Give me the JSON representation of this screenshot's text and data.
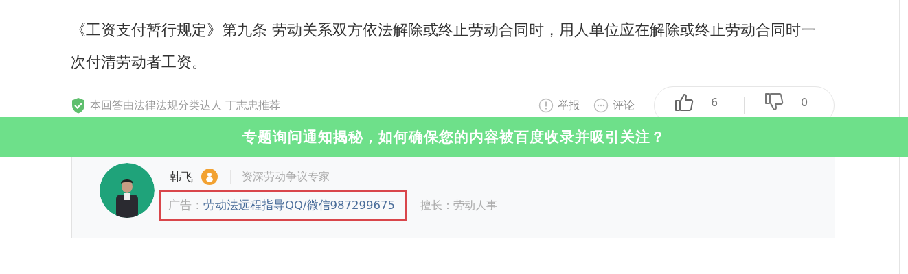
{
  "answer": {
    "text": "《工资支付暂行规定》第九条 劳动关系双方依法解除或终止劳动合同时，用人单位应在解除或终止劳动合同时一次付清劳动者工资。"
  },
  "meta": {
    "recommendation": "本回答由法律法规分类达人 丁志忠推荐",
    "actions": [
      {
        "kind": "report",
        "label": "举报"
      },
      {
        "kind": "comment",
        "label": "评论"
      }
    ],
    "votes": [
      {
        "kind": "up",
        "count": "6"
      },
      {
        "kind": "down",
        "count": "0"
      }
    ]
  },
  "banner": {
    "title": "专题询问通知揭秘，如何确保您的内容被百度收录并吸引关注？"
  },
  "author": {
    "name": "韩飞",
    "title": "资深劳动争议专家",
    "ad_label": "广告：",
    "ad_text": "劳动法远程指导QQ/微信987299675",
    "specialty": "擅长：劳动人事"
  }
}
